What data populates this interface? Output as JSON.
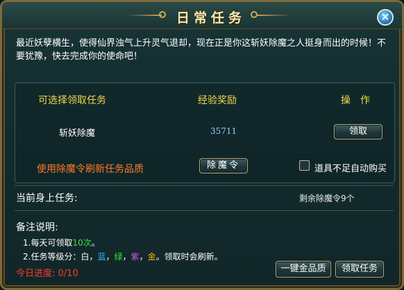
{
  "window": {
    "title": "日常任务"
  },
  "intro": "最近妖孽横生，使得仙界浊气上升灵气退却，现在正是你这斩妖除魔之人挺身而出的时候！不要犹豫，快去完成你的使命吧！",
  "table": {
    "headers": {
      "task": "可选择领取任务",
      "reward": "经验奖励",
      "action": "操　作"
    },
    "row": {
      "task": "斩妖除魔",
      "reward": "35711",
      "button": "领取"
    }
  },
  "refresh": {
    "label": "使用除魔令刷新任务品质",
    "button": "除魔令",
    "auto_buy_label": "道具不足自动购买"
  },
  "current": {
    "label": "当前身上任务:",
    "remaining": "剩余除魔令9个"
  },
  "notes": {
    "title": "备注说明:",
    "line1_prefix": "1.每天可领取",
    "line1_count": "10次",
    "line1_suffix": "。",
    "line2_prefix": "2.任务等级分：",
    "grades": [
      {
        "name": "白",
        "color": "#ffffff"
      },
      {
        "name": "蓝",
        "color": "#3ab4ff"
      },
      {
        "name": "绿",
        "color": "#39e33a"
      },
      {
        "name": "紫",
        "color": "#e24ce8"
      },
      {
        "name": "金",
        "color": "#ffb400"
      }
    ],
    "line2_suffix": "。领取时会刷新。"
  },
  "progress": {
    "label": "今日进度:",
    "value": "0/10"
  },
  "buttons": {
    "gold": "一键金品质",
    "accept": "领取任务"
  },
  "colors": {
    "header": "#f2d94a",
    "refresh_label": "#ff7a2a",
    "reward": "#8fd0ff",
    "progress": "#ff3a2a",
    "count": "#39e33a"
  }
}
